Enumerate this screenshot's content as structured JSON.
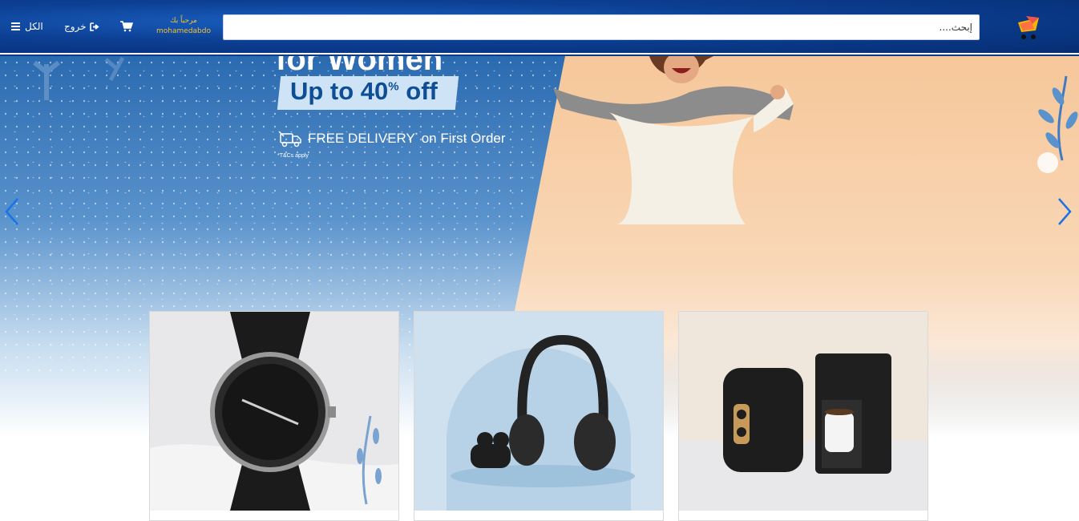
{
  "header": {
    "search": {
      "placeholder": "إبحث...."
    },
    "welcome": {
      "greeting": "مرحباً بك",
      "username": "mohamedabdo"
    },
    "logout_label": "خروج",
    "all_label": "الكل",
    "cart_icon": "cart-icon",
    "logo_icon": "shopping-cart-logo-icon"
  },
  "hero": {
    "headline_partial": "for Women",
    "offer": {
      "prefix": "Up to 40",
      "percent": "%",
      "suffix": " off"
    },
    "delivery": {
      "main": "FREE DELIVERY",
      "mark": "*",
      "rest": " on First Order"
    },
    "terms": "*T&Cs apply",
    "prev_icon": "chevron-left-icon",
    "next_icon": "chevron-right-icon",
    "colors": {
      "blue": "#2a6ab0",
      "peach": "#f6c79a",
      "accent": "#1a73e8"
    }
  },
  "cards": [
    {
      "name": "watch",
      "icon": "wristwatch-image"
    },
    {
      "name": "headphones",
      "icon": "headphones-image"
    },
    {
      "name": "kitchen-appliances",
      "icon": "air-fryer-coffee-maker-image"
    }
  ]
}
